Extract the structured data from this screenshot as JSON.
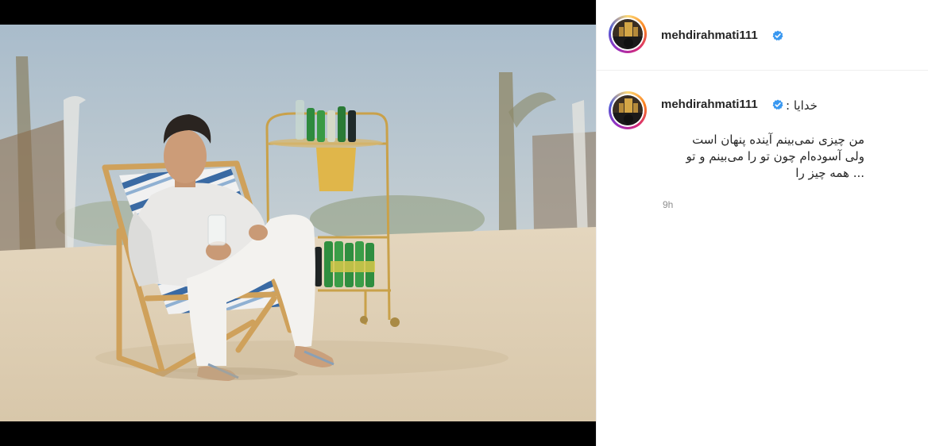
{
  "post": {
    "author": {
      "username": "mehdirahmati111",
      "verified": true,
      "verified_badge_color": "#3897f0"
    },
    "caption": {
      "title": "خدایا :",
      "lines": [
        "من چیزی نمی‌بینم آینده پنهان است",
        "ولی آسوده‌ام چون تو را می‌بینم و تو",
        "... همه چیز را"
      ]
    },
    "timestamp": "9h"
  },
  "colors": {
    "text": "#262626",
    "muted": "#8e8e8e",
    "divider": "#efefef",
    "letterbox": "#000000"
  }
}
